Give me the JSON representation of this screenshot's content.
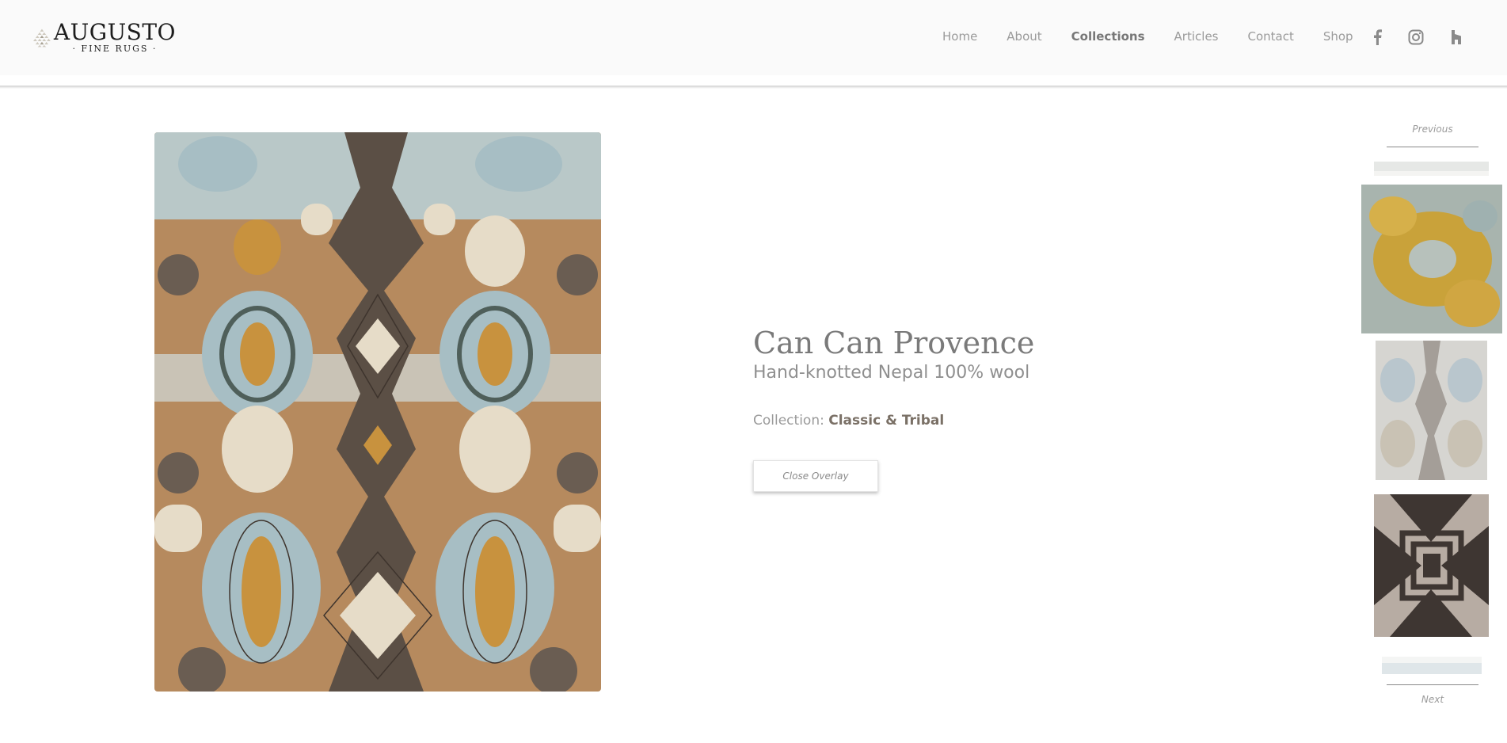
{
  "brand": {
    "name": "AUGUSTO",
    "tagline": "· FINE RUGS ·"
  },
  "nav": {
    "items": [
      {
        "label": "Home",
        "active": false
      },
      {
        "label": "About",
        "active": false
      },
      {
        "label": "Collections",
        "active": true
      },
      {
        "label": "Articles",
        "active": false
      },
      {
        "label": "Contact",
        "active": false
      },
      {
        "label": "Shop",
        "active": false
      }
    ],
    "social": [
      "facebook-icon",
      "instagram-icon",
      "houzz-icon"
    ]
  },
  "product": {
    "title": "Can Can Provence",
    "subtitle": "Hand-knotted Nepal 100% wool",
    "collection_label": "Collection:",
    "collection_value": "Classic & Tribal",
    "close_label": "Close Overlay"
  },
  "strip": {
    "previous_label": "Previous",
    "next_label": "Next"
  },
  "colors": {
    "rug_brown": "#8a5f3a",
    "rug_dark": "#5a4f46",
    "rug_blue": "#a9bfc6",
    "rug_gold": "#c9933f",
    "rug_cream": "#e8dcc6"
  }
}
